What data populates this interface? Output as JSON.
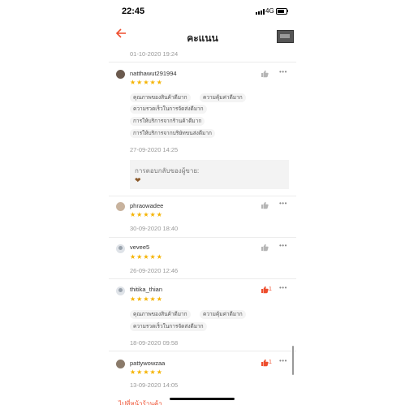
{
  "status_bar": {
    "time": "22:45",
    "network": "4G"
  },
  "header": {
    "title": "คะแนน"
  },
  "first_date": "01-10-2020 19:24",
  "reviews": [
    {
      "username": "natthawut291994",
      "stars": "★★★★★",
      "tags": [
        "คุณภาพของสินค้าดีมาก",
        "ความคุ้มค่าดีมาก",
        "ความรวดเร็วในการจัดส่งดีมาก",
        "การให้บริการจากร้านค้าดีมาก",
        "การให้บริการจากบริษัทขนส่งดีมาก"
      ],
      "date": "27-09-2020 14:25",
      "seller_reply_label": "การตอบกลับของผู้ขาย:",
      "seller_reply_icon": "heart-icon"
    },
    {
      "username": "phraowadee",
      "stars": "★★★★★",
      "date": "30-09-2020 18:40"
    },
    {
      "username": "vevee5",
      "stars": "★★★★★",
      "date": "26-09-2020 12:46"
    },
    {
      "username": "thitika_thian",
      "stars": "★★★★★",
      "likes": "1",
      "tags": [
        "คุณภาพของสินค้าดีมาก",
        "ความคุ้มค่าดีมาก",
        "ความรวดเร็วในการจัดส่งดีมาก"
      ],
      "date": "18-09-2020 09:58"
    },
    {
      "username": "pattywowzaa",
      "stars": "★★★★★",
      "likes": "1",
      "date": "13-09-2020 14:05"
    }
  ],
  "bottom_text": "ไปที่หน้าร้านค้า",
  "colors": {
    "accent": "#ee4d2d",
    "star": "#f5b301",
    "text_gray": "#999999",
    "tag_bg": "#f4f4f4"
  }
}
